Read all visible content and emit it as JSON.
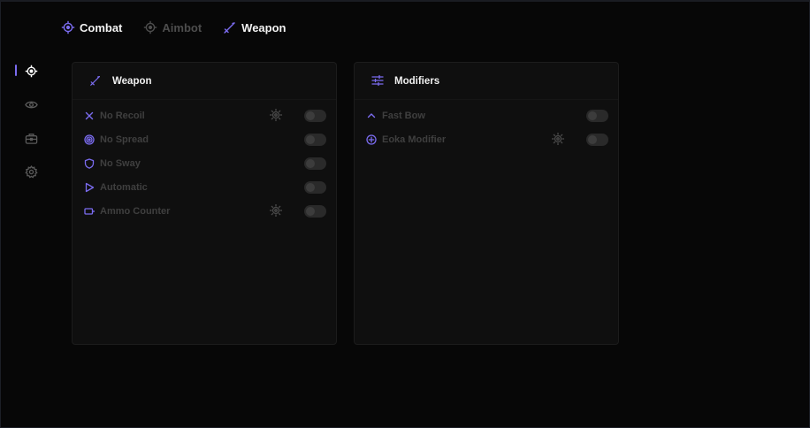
{
  "topbar": {
    "items": [
      {
        "label": "Combat",
        "icon": "crosshair-icon",
        "state": "active"
      },
      {
        "label": "Aimbot",
        "icon": "crosshair-icon",
        "state": "inactive"
      },
      {
        "label": "Weapon",
        "icon": "sword-icon",
        "state": "active"
      }
    ]
  },
  "sidebar": {
    "items": [
      {
        "icon": "crosshair-icon",
        "active": true
      },
      {
        "icon": "eye-icon",
        "active": false
      },
      {
        "icon": "toolbox-icon",
        "active": false
      },
      {
        "icon": "gear-icon",
        "active": false
      }
    ]
  },
  "panels": {
    "weapon": {
      "title": "Weapon",
      "icon": "sword-icon",
      "rows": [
        {
          "label": "No Recoil",
          "icon": "close-icon",
          "has_settings": true,
          "enabled": false
        },
        {
          "label": "No Spread",
          "icon": "target-icon",
          "has_settings": false,
          "enabled": false
        },
        {
          "label": "No Sway",
          "icon": "shield-icon",
          "has_settings": false,
          "enabled": false
        },
        {
          "label": "Automatic",
          "icon": "play-icon",
          "has_settings": false,
          "enabled": false
        },
        {
          "label": "Ammo Counter",
          "icon": "battery-icon",
          "has_settings": true,
          "enabled": false
        }
      ]
    },
    "modifiers": {
      "title": "Modifiers",
      "icon": "sliders-icon",
      "rows": [
        {
          "label": "Fast Bow",
          "icon": "chevron-up-icon",
          "has_settings": false,
          "enabled": false
        },
        {
          "label": "Eoka Modifier",
          "icon": "plus-circle-icon",
          "has_settings": true,
          "enabled": false
        }
      ]
    }
  },
  "colors": {
    "accent": "#7b6cf0",
    "background": "#070707",
    "panel": "#0f0f0f",
    "text_active": "#f2f2f2",
    "text_dim": "#3f3f3f"
  }
}
